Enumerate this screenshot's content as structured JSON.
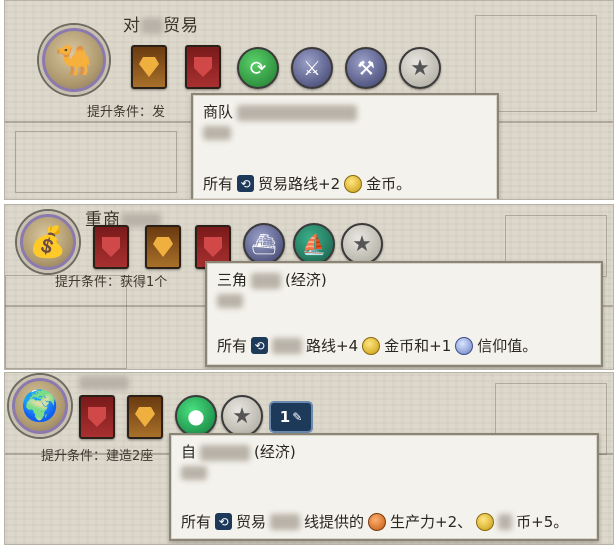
{
  "panels": [
    {
      "portrait_icon": "camel-icon",
      "name_visible": "对",
      "name_visible_tail": "贸易",
      "requirement_label": "提升条件：",
      "requirement_text": "发",
      "cards": [
        "gem-icon",
        "shield-icon"
      ],
      "round_icons": [
        "recycle-icon",
        "swords-icon",
        "axes-icon",
        "star-icon"
      ],
      "tooltip": {
        "title_visible": "商队",
        "line_prefix": "所有",
        "line_text": "贸易路线+2",
        "line_suffix": "金币。"
      }
    },
    {
      "portrait_icon": "money-bags-icon",
      "name_visible": "重商",
      "requirement_label": "提升条件：",
      "requirement_text": "获得1个",
      "cards": [
        "shield-icon",
        "gem-icon",
        "shield-icon"
      ],
      "round_icons": [
        "ship-icon",
        "sail-icon",
        "star-icon"
      ],
      "tooltip": {
        "title_visible": "三角",
        "title_tail": "(经济)",
        "line_prefix": "所有",
        "line_text": "路线+4",
        "line_mid": "金币和+1",
        "line_suffix": "信仰值。"
      }
    },
    {
      "portrait_icon": "globe-icon",
      "requirement_label": "提升条件：",
      "requirement_text": "建造2座",
      "cards": [
        "shield-icon",
        "gem-icon"
      ],
      "round_icons": [
        "green-gem-icon",
        "star-icon"
      ],
      "badge_number": "1",
      "tooltip": {
        "title_visible": "自",
        "title_tail": "(经济)",
        "line_prefix": "所有",
        "line_text_a": "贸易",
        "line_text_b": "线提供的",
        "line_mid": "生产力+2、",
        "line_suffix": "币+5。"
      }
    }
  ]
}
